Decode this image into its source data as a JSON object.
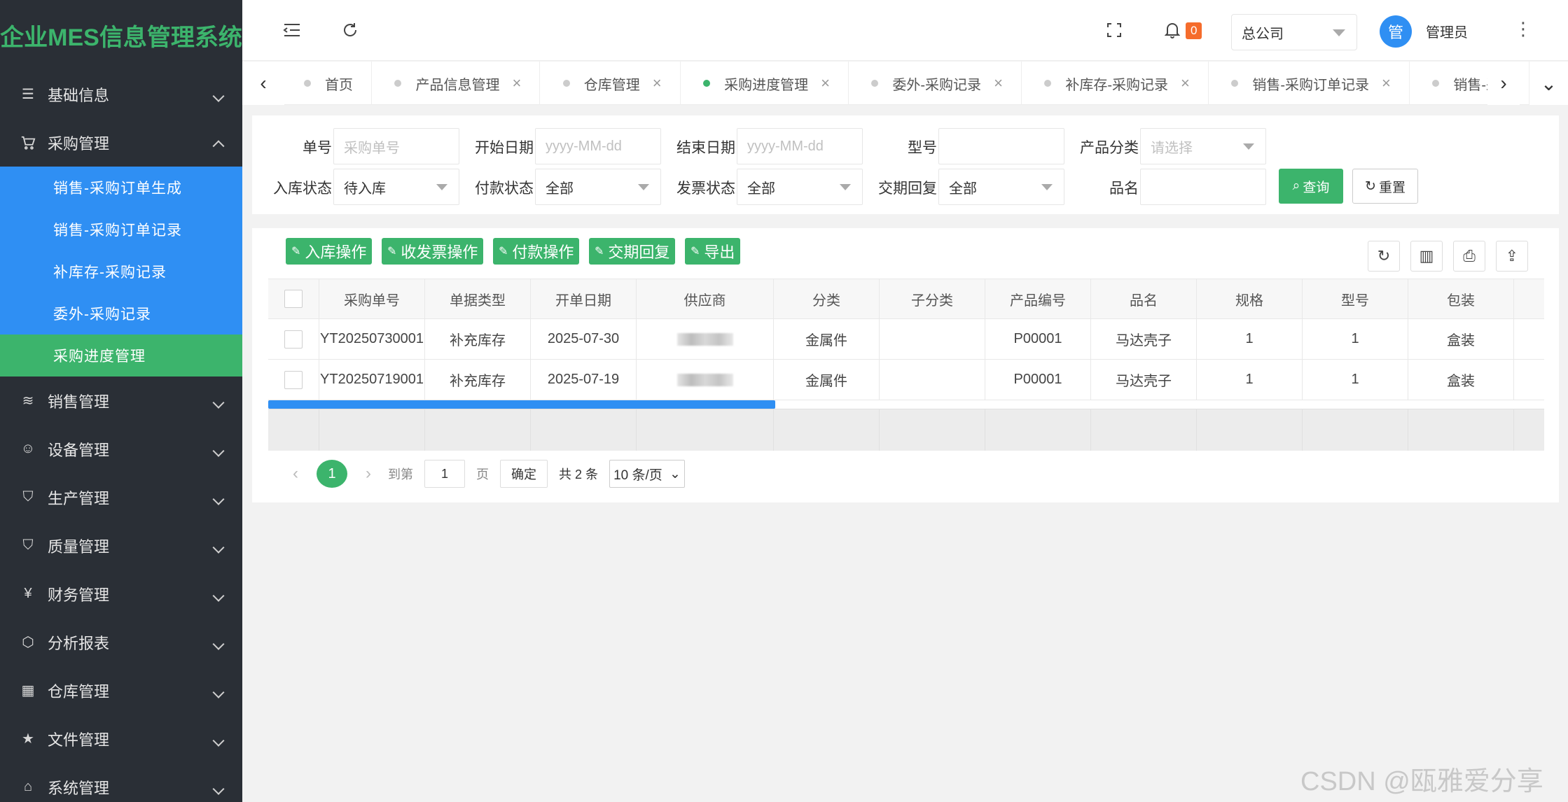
{
  "app": {
    "title": "企业MES信息管理系统"
  },
  "sidebar": {
    "items": [
      {
        "label": "基础信息",
        "icon": "list-icon",
        "glyph": "☰"
      },
      {
        "label": "采购管理",
        "icon": "cart-icon",
        "glyph": "🛒",
        "expanded": true,
        "children": [
          {
            "label": "销售-采购订单生成"
          },
          {
            "label": "销售-采购订单记录"
          },
          {
            "label": "补库存-采购记录"
          },
          {
            "label": "委外-采购记录"
          },
          {
            "label": "采购进度管理",
            "active": true
          }
        ]
      },
      {
        "label": "销售管理",
        "icon": "layers-icon",
        "glyph": "≋"
      },
      {
        "label": "设备管理",
        "icon": "smiley-icon",
        "glyph": "☺"
      },
      {
        "label": "生产管理",
        "icon": "shield-icon",
        "glyph": "⛉"
      },
      {
        "label": "质量管理",
        "icon": "shield-check-icon",
        "glyph": "⛉"
      },
      {
        "label": "财务管理",
        "icon": "yen-icon",
        "glyph": "¥"
      },
      {
        "label": "分析报表",
        "icon": "cube-icon",
        "glyph": "⬡"
      },
      {
        "label": "仓库管理",
        "icon": "building-icon",
        "glyph": "▦"
      },
      {
        "label": "文件管理",
        "icon": "star-icon",
        "glyph": "★"
      },
      {
        "label": "系统管理",
        "icon": "home-icon",
        "glyph": "⌂"
      }
    ]
  },
  "header": {
    "notification_count": "0",
    "company": "总公司",
    "avatar_text": "管",
    "username": "管理员"
  },
  "tabs": [
    {
      "label": "首页",
      "closable": false,
      "active": false
    },
    {
      "label": "产品信息管理",
      "closable": true,
      "active": false
    },
    {
      "label": "仓库管理",
      "closable": true,
      "active": false
    },
    {
      "label": "采购进度管理",
      "closable": true,
      "active": true
    },
    {
      "label": "委外-采购记录",
      "closable": true,
      "active": false
    },
    {
      "label": "补库存-采购记录",
      "closable": true,
      "active": false
    },
    {
      "label": "销售-采购订单记录",
      "closable": true,
      "active": false
    },
    {
      "label": "销售-采",
      "closable": false,
      "active": false
    }
  ],
  "filters": {
    "order_no": {
      "label": "单号",
      "placeholder": "采购单号"
    },
    "start_date": {
      "label": "开始日期",
      "placeholder": "yyyy-MM-dd"
    },
    "end_date": {
      "label": "结束日期",
      "placeholder": "yyyy-MM-dd"
    },
    "model": {
      "label": "型号",
      "value": ""
    },
    "category": {
      "label": "产品分类",
      "placeholder": "请选择"
    },
    "stock_status": {
      "label": "入库状态",
      "value": "待入库"
    },
    "pay_status": {
      "label": "付款状态",
      "value": "全部"
    },
    "invoice_status": {
      "label": "发票状态",
      "value": "全部"
    },
    "delivery_reply": {
      "label": "交期回复",
      "value": "全部"
    },
    "product_name": {
      "label": "品名",
      "value": ""
    },
    "query_label": "查询",
    "reset_label": "重置"
  },
  "actions": [
    {
      "label": "入库操作"
    },
    {
      "label": "收发票操作"
    },
    {
      "label": "付款操作"
    },
    {
      "label": "交期回复"
    },
    {
      "label": "导出"
    }
  ],
  "table": {
    "columns": [
      "采购单号",
      "单据类型",
      "开单日期",
      "供应商",
      "分类",
      "子分类",
      "产品编号",
      "品名",
      "规格",
      "型号",
      "包装"
    ],
    "rows": [
      [
        "YT20250730001",
        "补充库存",
        "2025-07-30",
        "",
        "金属件",
        "",
        "P00001",
        "马达壳子",
        "1",
        "1",
        "盒装"
      ],
      [
        "YT20250719001",
        "补充库存",
        "2025-07-19",
        "",
        "金属件",
        "",
        "P00001",
        "马达壳子",
        "1",
        "1",
        "盒装"
      ]
    ]
  },
  "pagination": {
    "current": "1",
    "goto_label": "到第",
    "goto_value": "1",
    "page_unit": "页",
    "confirm": "确定",
    "total": "共 2 条",
    "page_size": "10 条/页"
  },
  "watermark": "CSDN @瓯雅爱分享",
  "colors": {
    "sidebar_bg": "#2a2f36",
    "submenu_bg": "#2f8ff3",
    "accent_green": "#3cb46c",
    "badge": "#f56c2c"
  }
}
